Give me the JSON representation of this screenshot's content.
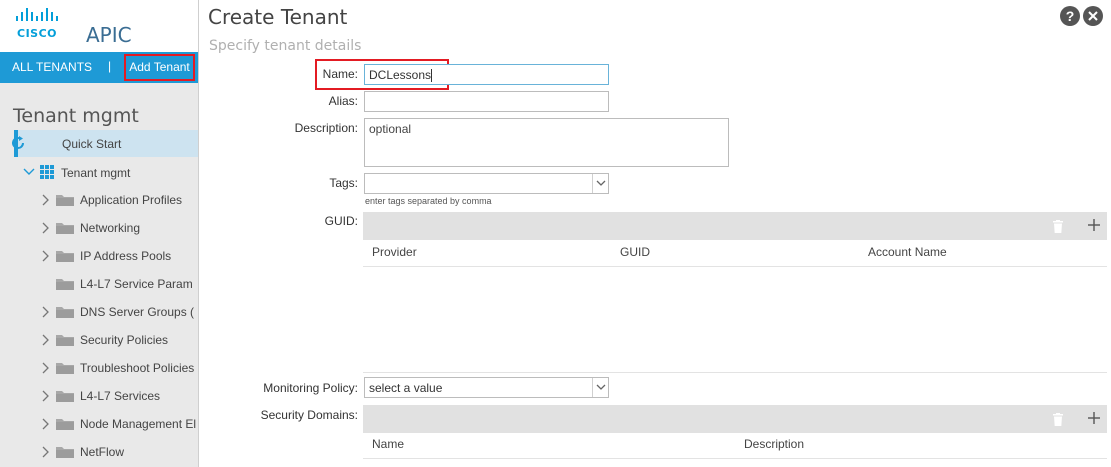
{
  "brand": {
    "logo_text": "CISCO",
    "app_name": "APIC"
  },
  "tenant_bar": {
    "all_tenants": "ALL TENANTS",
    "separator": "|",
    "add_tenant": "Add Tenant"
  },
  "sidebar": {
    "heading": "Tenant mgmt",
    "quick_start": "Quick Start",
    "tenant_node": "Tenant mgmt",
    "items": [
      {
        "label": "Application Profiles",
        "expandable": true
      },
      {
        "label": "Networking",
        "expandable": true
      },
      {
        "label": "IP Address Pools",
        "expandable": true
      },
      {
        "label": "L4-L7 Service Param",
        "expandable": false
      },
      {
        "label": "DNS Server Groups (",
        "expandable": true
      },
      {
        "label": "Security Policies",
        "expandable": true
      },
      {
        "label": "Troubleshoot Policies",
        "expandable": true
      },
      {
        "label": "L4-L7 Services",
        "expandable": true
      },
      {
        "label": "Node Management El",
        "expandable": true
      },
      {
        "label": "NetFlow",
        "expandable": true
      }
    ]
  },
  "form": {
    "title": "Create Tenant",
    "subtitle": "Specify tenant details",
    "help_icon": "?",
    "name": {
      "label": "Name:",
      "value": "DCLessons"
    },
    "alias": {
      "label": "Alias:",
      "value": ""
    },
    "description": {
      "label": "Description:",
      "placeholder": "optional"
    },
    "tags": {
      "label": "Tags:",
      "value": "",
      "hint": "enter tags separated by comma"
    },
    "guid": {
      "label": "GUID:",
      "columns": [
        "Provider",
        "GUID",
        "Account Name"
      ]
    },
    "monitoring_policy": {
      "label": "Monitoring Policy:",
      "placeholder": "select a value"
    },
    "security_domains": {
      "label": "Security Domains:",
      "columns": [
        "Name",
        "Description"
      ]
    }
  },
  "colors": {
    "accent": "#1e9ad6",
    "highlight": "#e31b23",
    "cisco_blue": "#049fd9"
  },
  "icons": [
    "cisco-logo",
    "quick-start-icon",
    "grid-icon",
    "folder-icon",
    "chevron-right-icon",
    "chevron-down-icon",
    "help-icon",
    "close-icon",
    "trash-icon",
    "plus-icon"
  ]
}
